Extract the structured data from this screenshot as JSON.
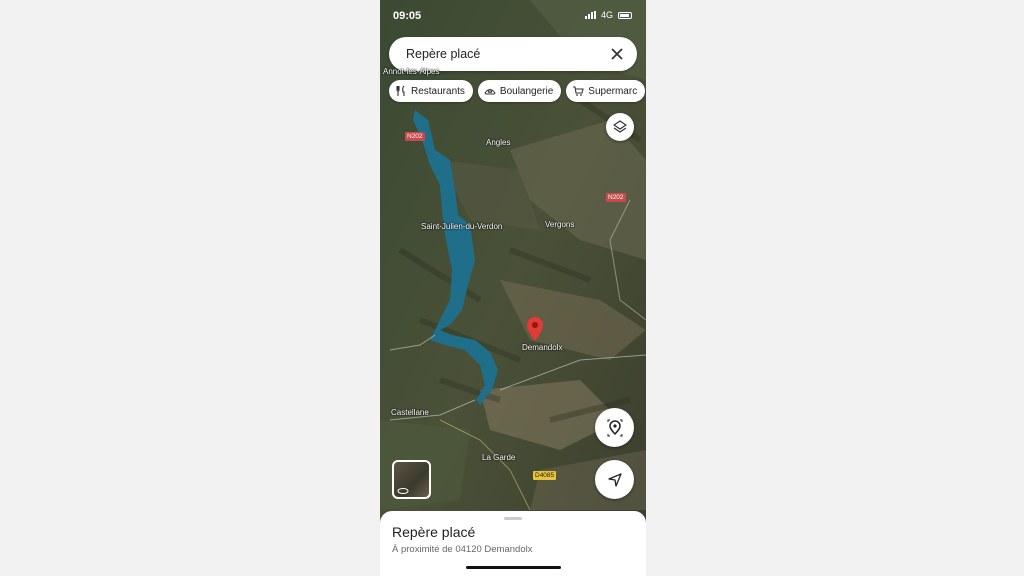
{
  "status": {
    "time": "09:05",
    "network": "4G"
  },
  "search": {
    "value": "Repère placé"
  },
  "chips": [
    {
      "label": "Restaurants",
      "icon": "fork-knife-icon"
    },
    {
      "label": "Boulangerie",
      "icon": "bread-icon"
    },
    {
      "label": "Supermarc",
      "icon": "cart-icon"
    }
  ],
  "map": {
    "place_labels": {
      "annot": "Annot-les-Alpes",
      "angles": "Angles",
      "saint_julien": "Saint-Julien-du-Verdon",
      "vergons": "Vergons",
      "demandolx": "Demandolx",
      "castellane": "Castellane",
      "la_garde": "La Garde"
    },
    "road_badges": {
      "n202_top": "N202",
      "n202_right": "N202",
      "d4085": "D4085"
    }
  },
  "sheet": {
    "title": "Repère placé",
    "subtitle": "À proximité de 04120 Demandolx"
  },
  "colors": {
    "marker": "#e53935",
    "lake": "#1f6f8b"
  }
}
